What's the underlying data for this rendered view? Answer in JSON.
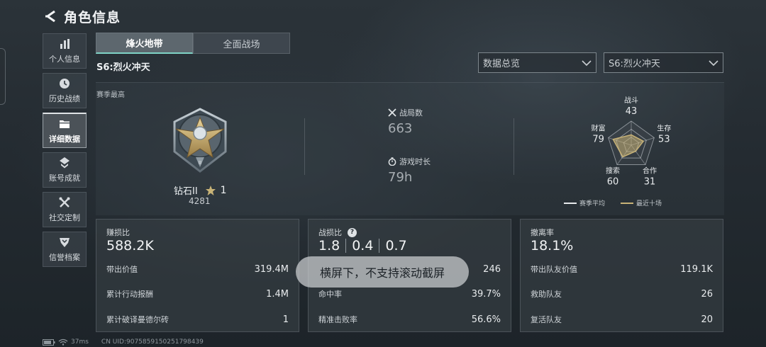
{
  "header": {
    "title": "角色信息",
    "back_icon": "chevron-left-icon"
  },
  "sidebar": {
    "items": [
      {
        "label": "个人信息",
        "icon": "bar-chart-icon",
        "active": false
      },
      {
        "label": "历史战绩",
        "icon": "history-clock-icon",
        "active": false
      },
      {
        "label": "详细数据",
        "icon": "folder-icon",
        "active": true
      },
      {
        "label": "账号成就",
        "icon": "achievement-icon",
        "active": false
      },
      {
        "label": "社交定制",
        "icon": "tools-icon",
        "active": false
      },
      {
        "label": "信誉档案",
        "icon": "shield-icon",
        "active": false
      }
    ]
  },
  "tabs": [
    {
      "label": "烽火地带",
      "active": true
    },
    {
      "label": "全面战场",
      "active": false
    }
  ],
  "season_title": "S6:烈火冲天",
  "filters": {
    "view_value": "数据总览",
    "season_value": "S6:烈火冲天"
  },
  "overview": {
    "season_best_label": "赛季最高",
    "rank": {
      "name": "钻石II",
      "stars": "1",
      "score": "4281"
    },
    "matches": {
      "label": "战局数",
      "value": "663"
    },
    "playtime": {
      "label": "游戏时长",
      "value": "79h"
    }
  },
  "chart_data": {
    "type": "radar",
    "axes": [
      {
        "label": "战斗",
        "value": 43
      },
      {
        "label": "生存",
        "value": 53
      },
      {
        "label": "合作",
        "value": 31
      },
      {
        "label": "搜索",
        "value": 60
      },
      {
        "label": "财富",
        "value": 79
      }
    ],
    "series": [
      {
        "name": "赛季平均",
        "color": "#e8ebed"
      },
      {
        "name": "最近十场",
        "color": "#c8b377"
      }
    ],
    "range": [
      0,
      100
    ]
  },
  "cards": {
    "profit": {
      "label": "赚损比",
      "value": "588.2K",
      "rows": [
        {
          "label": "带出价值",
          "value": "319.4M"
        },
        {
          "label": "累计行动报酬",
          "value": "1.4M"
        },
        {
          "label": "累计破译曼德尔砖",
          "value": "1"
        }
      ]
    },
    "combat": {
      "label": "战损比",
      "ratios": [
        "1.8",
        "0.4",
        "0.7"
      ],
      "rows": [
        {
          "label": "",
          "value": "246"
        },
        {
          "label": "命中率",
          "value": "39.7%"
        },
        {
          "label": "精准击败率",
          "value": "56.6%"
        }
      ]
    },
    "extract": {
      "label": "撤离率",
      "value": "18.1%",
      "rows": [
        {
          "label": "带出队友价值",
          "value": "119.1K"
        },
        {
          "label": "救助队友",
          "value": "26"
        },
        {
          "label": "复活队友",
          "value": "20"
        }
      ]
    }
  },
  "toast": "横屏下，不支持滚动截屏",
  "footer": {
    "ping": "37ms",
    "uid": "CN UID:9075859150251798439"
  },
  "colors": {
    "accent": "#7fd3c6",
    "gold": "#c8b377"
  }
}
